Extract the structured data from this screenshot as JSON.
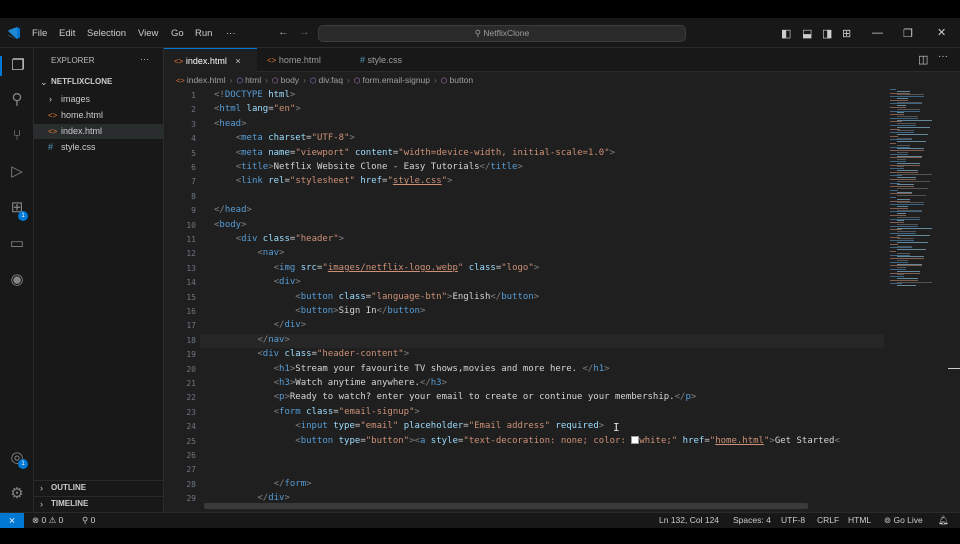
{
  "menu": {
    "items": [
      "File",
      "Edit",
      "Selection",
      "View",
      "Go",
      "Run",
      "···"
    ],
    "search_text": "NetflixClone"
  },
  "activity": {
    "icons": [
      "files-icon",
      "search-icon",
      "source-control-icon",
      "run-debug-icon",
      "extensions-icon",
      "remote-explorer-icon",
      "github-icon"
    ],
    "extensions_badge": "1",
    "accounts_badge": "1"
  },
  "explorer": {
    "title": "EXPLORER",
    "more": "···",
    "project": "NETFLIXCLONE",
    "items": [
      {
        "label": "images",
        "kind": "folder"
      },
      {
        "label": "home.html",
        "kind": "html"
      },
      {
        "label": "index.html",
        "kind": "html"
      },
      {
        "label": "style.css",
        "kind": "css"
      }
    ],
    "outline": "OUTLINE",
    "timeline": "TIMELINE"
  },
  "tabs": [
    {
      "label": "index.html",
      "icon": "<>",
      "active": true,
      "close": "×"
    },
    {
      "label": "home.html",
      "icon": "<>",
      "active": false
    },
    {
      "label": "style.css",
      "icon": "#",
      "active": false
    }
  ],
  "breadcrumb": [
    "index.html",
    "html",
    "body",
    "div.faq",
    "form.email-signup",
    "button"
  ],
  "code_lines": [
    {
      "n": "1",
      "html": "<span class='b'>&lt;!</span><span class='d'>DOCTYPE</span> <span class='a'>html</span><span class='b'>&gt;</span>"
    },
    {
      "n": "2",
      "html": "<span class='b'>&lt;</span><span class='t'>html</span> <span class='a'>lang</span>=<span class='s'>\"en\"</span><span class='b'>&gt;</span>"
    },
    {
      "n": "3",
      "html": "<span class='b'>&lt;</span><span class='t'>head</span><span class='b'>&gt;</span>"
    },
    {
      "n": "4",
      "html": "    <span class='b'>&lt;</span><span class='t'>meta</span> <span class='a'>charset</span>=<span class='s'>\"UTF-8\"</span><span class='b'>&gt;</span>"
    },
    {
      "n": "5",
      "html": "    <span class='b'>&lt;</span><span class='t'>meta</span> <span class='a'>name</span>=<span class='s'>\"viewport\"</span> <span class='a'>content</span>=<span class='s'>\"width=device-width, initial-scale=1.0\"</span><span class='b'>&gt;</span>"
    },
    {
      "n": "6",
      "html": "    <span class='b'>&lt;</span><span class='t'>title</span><span class='b'>&gt;</span><span class='tx'>Netflix Website Clone - Easy Tutorials</span><span class='b'>&lt;/</span><span class='t'>title</span><span class='b'>&gt;</span>"
    },
    {
      "n": "7",
      "html": "    <span class='b'>&lt;</span><span class='t'>link</span> <span class='a'>rel</span>=<span class='s'>\"stylesheet\"</span> <span class='a'>href</span>=<span class='s'>\"<span class='u'>style.css</span>\"</span><span class='b'>&gt;</span>"
    },
    {
      "n": "8",
      "html": ""
    },
    {
      "n": "9",
      "html": "<span class='b'>&lt;/</span><span class='t'>head</span><span class='b'>&gt;</span>"
    },
    {
      "n": "10",
      "html": "<span class='b'>&lt;</span><span class='t'>body</span><span class='b'>&gt;</span>"
    },
    {
      "n": "11",
      "html": "    <span class='b'>&lt;</span><span class='t'>div</span> <span class='a'>class</span>=<span class='s'>\"header\"</span><span class='b'>&gt;</span>"
    },
    {
      "n": "12",
      "html": "        <span class='b'>&lt;</span><span class='t'>nav</span><span class='b'>&gt;</span>"
    },
    {
      "n": "13",
      "html": "           <span class='b'>&lt;</span><span class='t'>img</span> <span class='a'>src</span>=<span class='s'>\"<span class='u'>images/netflix-logo.webp</span>\"</span> <span class='a'>class</span>=<span class='s'>\"logo\"</span><span class='b'>&gt;</span>"
    },
    {
      "n": "14",
      "html": "           <span class='b'>&lt;</span><span class='t'>div</span><span class='b'>&gt;</span>"
    },
    {
      "n": "15",
      "html": "               <span class='b'>&lt;</span><span class='t'>button</span> <span class='a'>class</span>=<span class='s'>\"language-btn\"</span><span class='b'>&gt;</span><span class='tx'>English</span><span class='b'>&lt;/</span><span class='t'>button</span><span class='b'>&gt;</span>"
    },
    {
      "n": "16",
      "html": "               <span class='b'>&lt;</span><span class='t'>button</span><span class='b'>&gt;</span><span class='tx'>Sign In</span><span class='b'>&lt;/</span><span class='t'>button</span><span class='b'>&gt;</span>"
    },
    {
      "n": "17",
      "html": "           <span class='b'>&lt;/</span><span class='t'>div</span><span class='b'>&gt;</span>"
    },
    {
      "n": "18",
      "html": "        <span class='b'>&lt;/</span><span class='t'>nav</span><span class='b'>&gt;</span>"
    },
    {
      "n": "19",
      "html": "        <span class='b'>&lt;</span><span class='t'>div</span> <span class='a'>class</span>=<span class='s'>\"header-content\"</span><span class='b'>&gt;</span>"
    },
    {
      "n": "20",
      "html": "           <span class='b'>&lt;</span><span class='t'>h1</span><span class='b'>&gt;</span><span class='tx'>Stream your favourite TV shows,movies and more here. </span><span class='b'>&lt;/</span><span class='t'>h1</span><span class='b'>&gt;</span>"
    },
    {
      "n": "21",
      "html": "           <span class='b'>&lt;</span><span class='t'>h3</span><span class='b'>&gt;</span><span class='tx'>Watch anytime anywhere.</span><span class='b'>&lt;/</span><span class='t'>h3</span><span class='b'>&gt;</span>"
    },
    {
      "n": "22",
      "html": "           <span class='b'>&lt;</span><span class='t'>p</span><span class='b'>&gt;</span><span class='tx'>Ready to watch? enter your email to create or continue your membership.</span><span class='b'>&lt;/</span><span class='t'>p</span><span class='b'>&gt;</span>"
    },
    {
      "n": "23",
      "html": "           <span class='b'>&lt;</span><span class='t'>form</span> <span class='a'>class</span>=<span class='s'>\"email-signup\"</span><span class='b'>&gt;</span>"
    },
    {
      "n": "24",
      "html": "               <span class='b'>&lt;</span><span class='t'>input</span> <span class='a'>type</span>=<span class='s'>\"email\"</span> <span class='a'>placeholder</span>=<span class='s'>\"Email address\"</span> <span class='a'>required</span><span class='b'>&gt;</span>"
    },
    {
      "n": "25",
      "html": "               <span class='b'>&lt;</span><span class='t'>button</span> <span class='a'>type</span>=<span class='s'>\"button\"</span><span class='b'>&gt;</span><span class='b'>&lt;</span><span class='t'>a</span> <span class='a'>style</span>=<span class='s'>\"text-decoration: none; color: <span style='display:inline-block;width:8px;height:8px;background:#fff;border:1px solid #999;vertical-align:-1px'></span>white;\"</span> <span class='a'>href</span>=<span class='s'>\"<span class='u'>home.html</span>\"</span><span class='b'>&gt;</span><span class='tx'>Get Started</span><span class='b'>&lt;</span>"
    },
    {
      "n": "26",
      "html": ""
    },
    {
      "n": "27",
      "html": ""
    },
    {
      "n": "28",
      "html": "           <span class='b'>&lt;/</span><span class='t'>form</span><span class='b'>&gt;</span>"
    },
    {
      "n": "29",
      "html": "        <span class='b'>&lt;/</span><span class='t'>div</span><span class='b'>&gt;</span>"
    }
  ],
  "status": {
    "remote": "⨯",
    "errors": "⊗ 0 ⚠ 0",
    "ports": "⚲ 0",
    "cursor": "Ln 132, Col 124",
    "spaces": "Spaces: 4",
    "encoding": "UTF-8",
    "eol": "CRLF",
    "language": "HTML",
    "golive": "Go Live"
  }
}
